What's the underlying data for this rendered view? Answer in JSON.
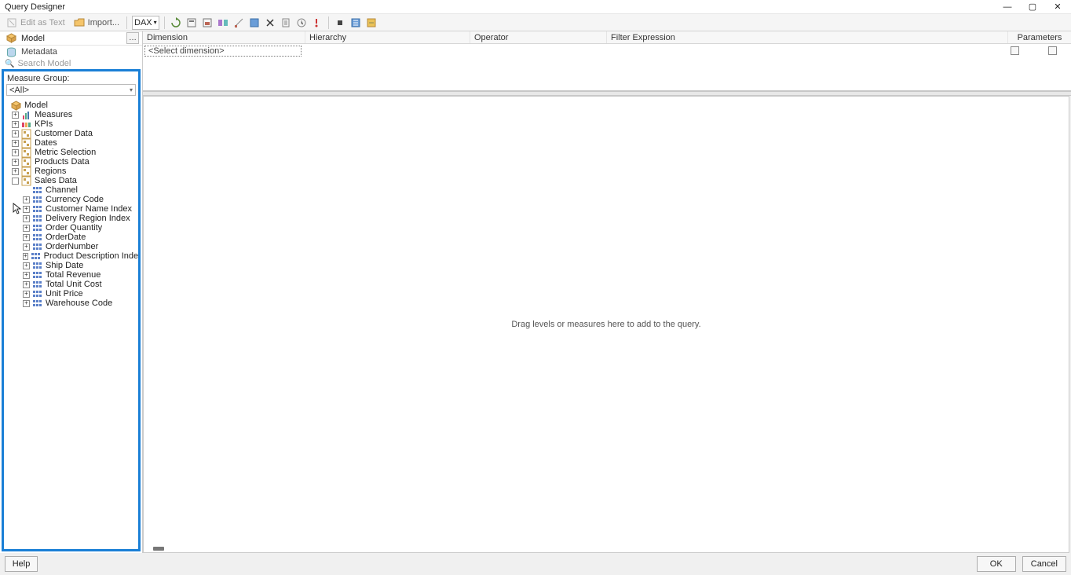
{
  "window": {
    "title": "Query Designer"
  },
  "toolbar": {
    "edit_as_text": "Edit as Text",
    "import": "Import...",
    "lang_select": "DAX"
  },
  "left": {
    "cube_label": "Model",
    "metadata_tab": "Metadata",
    "search_placeholder": "Search Model",
    "measure_group_label": "Measure Group:",
    "measure_group_value": "<All>",
    "tree_root": "Model",
    "top_nodes": [
      {
        "label": "Measures",
        "icon": "measures"
      },
      {
        "label": "KPIs",
        "icon": "kpi"
      },
      {
        "label": "Customer Data",
        "icon": "dim"
      },
      {
        "label": "Dates",
        "icon": "dim"
      },
      {
        "label": "Metric Selection",
        "icon": "dim"
      },
      {
        "label": "Products Data",
        "icon": "dim"
      },
      {
        "label": "Regions",
        "icon": "dim"
      }
    ],
    "expanded_node": "Sales Data",
    "children": [
      "Channel",
      "Currency Code",
      "Customer Name Index",
      "Delivery Region Index",
      "Order Quantity",
      "OrderDate",
      "OrderNumber",
      "Product Description Index",
      "Ship Date",
      "Total Revenue",
      "Total Unit Cost",
      "Unit Price",
      "Warehouse Code"
    ]
  },
  "filter": {
    "col_dimension": "Dimension",
    "col_hierarchy": "Hierarchy",
    "col_operator": "Operator",
    "col_expression": "Filter Expression",
    "col_parameters": "Parameters",
    "placeholder": "<Select dimension>"
  },
  "canvas": {
    "hint": "Drag levels or measures here to add to the query."
  },
  "footer": {
    "help": "Help",
    "ok": "OK",
    "cancel": "Cancel"
  }
}
